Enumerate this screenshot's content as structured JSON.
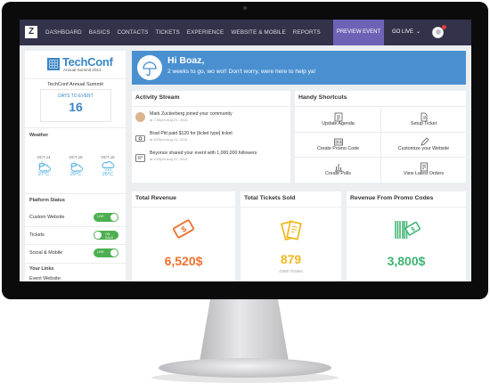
{
  "nav": {
    "logo": "Z",
    "items": [
      "DASHBOARD",
      "BASICS",
      "CONTACTS",
      "TICKETS",
      "EXPERIENCE",
      "WEBSITE & MOBILE",
      "REPORTS"
    ],
    "preview_label": "PREVIEW EVENT",
    "golive_label": "GO LIVE",
    "golive_chevron": "⌄"
  },
  "sidebar": {
    "brand_name": "TechConf",
    "brand_sub": "Annual Summit 2014",
    "event_title": "TechConf Annual Summit",
    "days_label": "DAYS TO EVENT",
    "days_value": "16",
    "weather_heading": "Weather",
    "weather": [
      {
        "date": "OCT 14",
        "temp": "27°C",
        "icon": "sun-cloud"
      },
      {
        "date": "OCT 15",
        "temp": "29°C",
        "icon": "sun-cloud"
      },
      {
        "date": "OCT 16",
        "temp": "25°C",
        "icon": "cloud-rain"
      }
    ],
    "platform_heading": "Platform Status",
    "platform": [
      {
        "label": "Custom Website",
        "toggle": "LIVE",
        "color": "#4caf50"
      },
      {
        "label": "Tickets",
        "toggle": "ON SALE",
        "color": "#4caf50"
      },
      {
        "label": "Social & Mobile",
        "toggle": "LIVE",
        "color": "#4caf50"
      }
    ],
    "links_heading": "Your Links",
    "links": [
      "Event Website:"
    ]
  },
  "banner": {
    "title": "Hi Boaz,",
    "subtitle": "2 weeks to go, wo wo!! Don't worry, were here to help ya!"
  },
  "activity": {
    "heading": "Activity Stream",
    "items": [
      {
        "text": "Mark Zuckerberg joined your community",
        "time": "at 7:50pm Aug 21, 2014",
        "icon": "avatar"
      },
      {
        "text": "Brad Pitt paid $120 for [ticket type] ticket",
        "time": "at 8:20pm Aug 21, 2014",
        "icon": "money-icon"
      },
      {
        "text": "Beyonce shared your event with 1,000,000 followers",
        "time": "at 9:20pm Aug 21, 2014",
        "icon": "share-icon"
      }
    ]
  },
  "shortcuts": {
    "heading": "Handy Shortcuts",
    "items": [
      "Update Agenda",
      "Setup Ticket",
      "Create Promo Code",
      "Customize your Website",
      "Create Polls",
      "View Latest Orders"
    ]
  },
  "stats": [
    {
      "heading": "Total Revenue",
      "value": "6,520$",
      "sub": "",
      "color": "#f0702e",
      "icon": "money-tag-icon"
    },
    {
      "heading": "Total Tickets Sold",
      "value": "879",
      "sub": "/1500 Tickets",
      "color": "#f2b61e",
      "icon": "tickets-icon"
    },
    {
      "heading": "Revenue From Promo Codes",
      "value": "3,800$",
      "sub": "",
      "color": "#3bb371",
      "icon": "barcode-icon"
    }
  ]
}
